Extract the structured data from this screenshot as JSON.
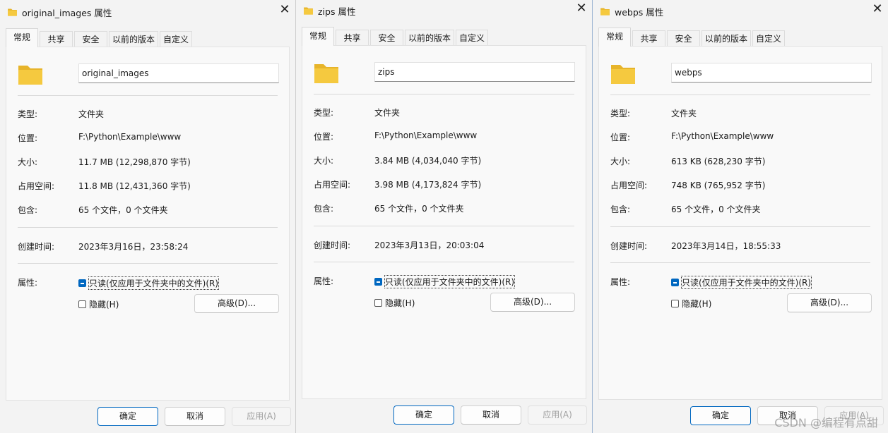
{
  "common": {
    "tabs": [
      "常规",
      "共享",
      "安全",
      "以前的版本",
      "自定义"
    ],
    "labels": {
      "type": "类型:",
      "location": "位置:",
      "size": "大小:",
      "size_on_disk": "占用空间:",
      "contains": "包含:",
      "created": "创建时间:",
      "attributes": "属性:"
    },
    "readonly_label": "只读(仅应用于文件夹中的文件)(R)",
    "hidden_label": "隐藏(H)",
    "advanced_label": "高级(D)...",
    "ok_label": "确定",
    "cancel_label": "取消",
    "apply_label": "应用(A)",
    "close_glyph": "✕"
  },
  "windows": [
    {
      "title": "original_images 属性",
      "name": "original_images",
      "type": "文件夹",
      "location": "F:\\Python\\Example\\www",
      "size": "11.7 MB (12,298,870 字节)",
      "size_on_disk": "11.8 MB (12,431,360 字节)",
      "contains": "65 个文件，0 个文件夹",
      "created": "2023年3月16日，23:58:24"
    },
    {
      "title": "zips 属性",
      "name": "zips",
      "type": "文件夹",
      "location": "F:\\Python\\Example\\www",
      "size": "3.84 MB (4,034,040 字节)",
      "size_on_disk": "3.98 MB (4,173,824 字节)",
      "contains": "65 个文件，0 个文件夹",
      "created": "2023年3月13日，20:03:04"
    },
    {
      "title": "webps 属性",
      "name": "webps",
      "type": "文件夹",
      "location": "F:\\Python\\Example\\www",
      "size": "613 KB (628,230 字节)",
      "size_on_disk": "748 KB (765,952 字节)",
      "contains": "65 个文件，0 个文件夹",
      "created": "2023年3月14日，18:55:33"
    }
  ],
  "watermark": "CSDN @编程有点甜",
  "colors": {
    "folder": "#f5c93f",
    "folder_back": "#e7b42a",
    "accent": "#0067c0"
  }
}
